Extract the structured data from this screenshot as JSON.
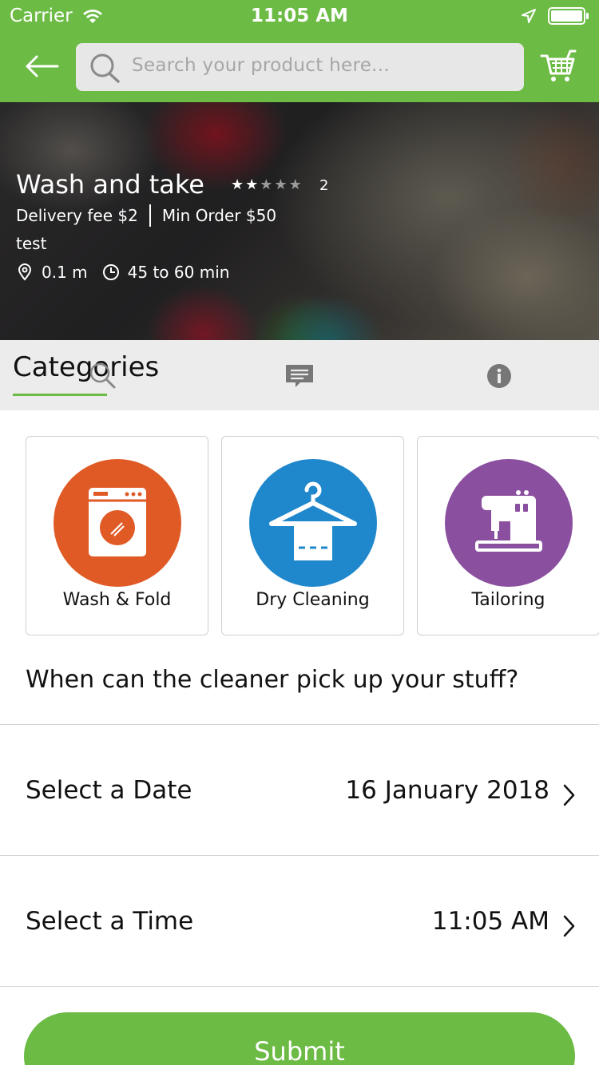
{
  "status_bar": {
    "carrier": "Carrier",
    "time": "11:05 AM"
  },
  "header": {
    "search_placeholder": "Search your product here...",
    "accent_color": "#6cbb45"
  },
  "store": {
    "name": "Wash and take",
    "rating": 2,
    "rating_max": 5,
    "rating_count": "2",
    "delivery_fee_label": "Delivery fee",
    "delivery_fee_value": "$2",
    "min_order_label": "Min Order",
    "min_order_value": "$50",
    "description": "test",
    "distance": "0.1 m",
    "delivery_time": "45 to 60 min"
  },
  "tabs": {
    "categories_label": "Categories"
  },
  "categories": [
    {
      "label": "Wash & Fold",
      "color": "#e05a26",
      "icon": "washing-machine-icon"
    },
    {
      "label": "Dry Cleaning",
      "color": "#1f87cb",
      "icon": "hanger-icon"
    },
    {
      "label": "Tailoring",
      "color": "#8a4f9e",
      "icon": "sewing-machine-icon"
    }
  ],
  "pickup": {
    "question": "When can the cleaner pick up your stuff?",
    "date_label": "Select a Date",
    "date_value": "16 January 2018",
    "time_label": "Select a Time",
    "time_value": "11:05 AM"
  },
  "submit_label": "Submit"
}
